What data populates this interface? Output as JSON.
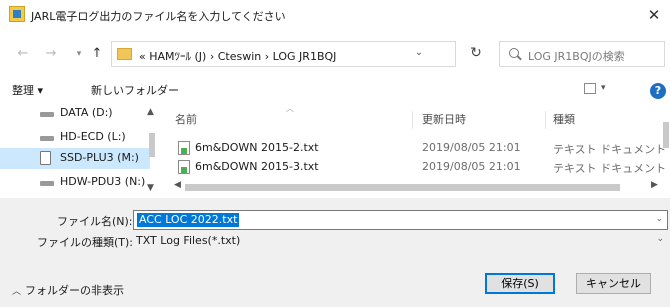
{
  "window": {
    "title": "JARL電子ログ出力のファイル名を入力してください",
    "close": "✕"
  },
  "address": {
    "path": "« HAMﾂｰﾙ (J) › Cteswin › LOG JR1BQJ",
    "search_placeholder": "LOG JR1BQJの検索"
  },
  "toolbar": {
    "organize": "整理 ▾",
    "new_folder": "新しいフォルダー"
  },
  "nav": {
    "drives": [
      {
        "label": "DATA (D:)",
        "selected": false
      },
      {
        "label": "HD-ECD (L:)",
        "selected": false
      },
      {
        "label": "SSD-PLU3 (M:)",
        "selected": true
      },
      {
        "label": "HDW-PDU3 (N:)",
        "selected": false
      }
    ]
  },
  "columns": {
    "name": "名前",
    "date": "更新日時",
    "type": "種類"
  },
  "files": [
    {
      "name": "6m&DOWN 2015-2.txt",
      "date": "2019/08/05 21:01",
      "type": "テキスト ドキュメント"
    },
    {
      "name": "6m&DOWN 2015-3.txt",
      "date": "2019/08/05 21:01",
      "type": "テキスト ドキュメント"
    }
  ],
  "form": {
    "filename_label": "ファイル名(N):",
    "filename_value": "ACC LOC 2022.txt",
    "filetype_label": "ファイルの種類(T):",
    "filetype_value": "TXT Log Files(*.txt)"
  },
  "footer": {
    "hide_folders": "フォルダーの非表示",
    "save": "保存(S)",
    "cancel": "キャンセル"
  }
}
